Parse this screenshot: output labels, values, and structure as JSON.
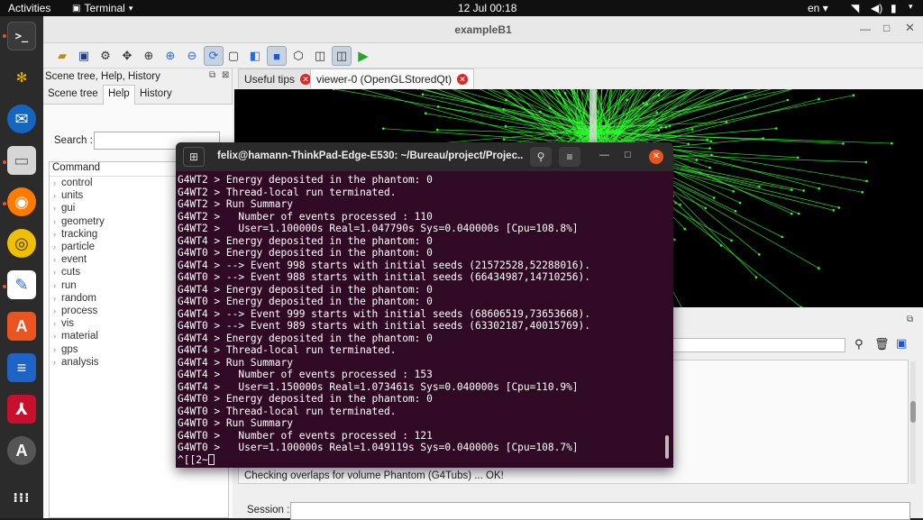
{
  "topbar": {
    "activities": "Activities",
    "app_name": "Terminal",
    "clock": "12 Jul  00:18",
    "keyboard_layout": "en"
  },
  "window": {
    "title": "exampleB1"
  },
  "left_panel": {
    "title": "Scene tree, Help, History",
    "tabs": [
      "Scene tree",
      "Help",
      "History"
    ],
    "active_tab": "Help",
    "search_label": "Search :",
    "search_value": "",
    "tree_header": "Command",
    "tree_items": [
      "control",
      "units",
      "gui",
      "geometry",
      "tracking",
      "particle",
      "event",
      "cuts",
      "run",
      "random",
      "process",
      "vis",
      "material",
      "gps",
      "analysis"
    ]
  },
  "right_panel": {
    "tabs": [
      {
        "label": "Useful tips"
      },
      {
        "label": "viewer-0 (OpenGLStoredQt)"
      }
    ],
    "active_tab": "viewer-0 (OpenGLStoredQt)",
    "output_partial_line": "Checking overlaps for volume Phantom (G4Tubs) ... OK!",
    "session_label": "Session :",
    "session_value": ""
  },
  "terminal": {
    "title": "felix@hamann-ThinkPad-Edge-E530: ~/Bureau/project/Projec...",
    "lines": [
      "G4WT2 > Energy deposited in the phantom: 0",
      "G4WT2 > Thread-local run terminated.",
      "G4WT2 > Run Summary",
      "G4WT2 >   Number of events processed : 110",
      "G4WT2 >   User=1.100000s Real=1.047790s Sys=0.040000s [Cpu=108.8%]",
      "G4WT4 > Energy deposited in the phantom: 0",
      "G4WT0 > Energy deposited in the phantom: 0",
      "G4WT4 > --> Event 998 starts with initial seeds (21572528,52288016).",
      "G4WT0 > --> Event 988 starts with initial seeds (66434987,14710256).",
      "G4WT4 > Energy deposited in the phantom: 0",
      "G4WT0 > Energy deposited in the phantom: 0",
      "G4WT4 > --> Event 999 starts with initial seeds (68606519,73653668).",
      "G4WT0 > --> Event 989 starts with initial seeds (63302187,40015769).",
      "G4WT4 > Energy deposited in the phantom: 0",
      "G4WT4 > Thread-local run terminated.",
      "G4WT4 > Run Summary",
      "G4WT4 >   Number of events processed : 153",
      "G4WT4 >   User=1.150000s Real=1.073461s Sys=0.040000s [Cpu=110.9%]",
      "G4WT0 > Energy deposited in the phantom: 0",
      "G4WT0 > Thread-local run terminated.",
      "G4WT0 > Run Summary",
      "G4WT0 >   Number of events processed : 121",
      "G4WT0 >   User=1.100000s Real=1.049119s Sys=0.040000s [Cpu=108.7%]"
    ],
    "prompt_line": "^[[2~"
  },
  "colors": {
    "terminal_bg": "#300a24",
    "viewer_bg": "#000000",
    "track_color": "#33ff33",
    "close_red": "#e95420"
  }
}
